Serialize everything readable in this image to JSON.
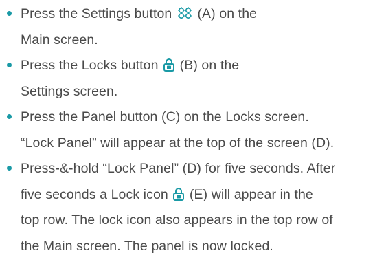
{
  "accent_color": "#1a9aa6",
  "text_color": "#4a4a4a",
  "steps": [
    {
      "line1_before": "Press the Settings button",
      "icon": "settings-gear-icon",
      "line1_after": "(A) on the",
      "line2": "Main screen."
    },
    {
      "line1_before": "Press the Locks button",
      "icon": "lock-icon",
      "line1_after": "(B) on the",
      "line2": "Settings screen."
    },
    {
      "line1": "Press the Panel button (C) on the Locks screen.",
      "line2": "“Lock Panel” will appear at the top of the screen (D)."
    },
    {
      "line1": "Press-&-hold “Lock Panel” (D) for five seconds. After",
      "line2_before": "five seconds a Lock icon",
      "icon": "lock-icon",
      "line2_after": "(E) will appear in the",
      "line3": "top row. The lock icon also appears in the top row of",
      "line4": "the Main screen. The panel is now locked."
    }
  ]
}
